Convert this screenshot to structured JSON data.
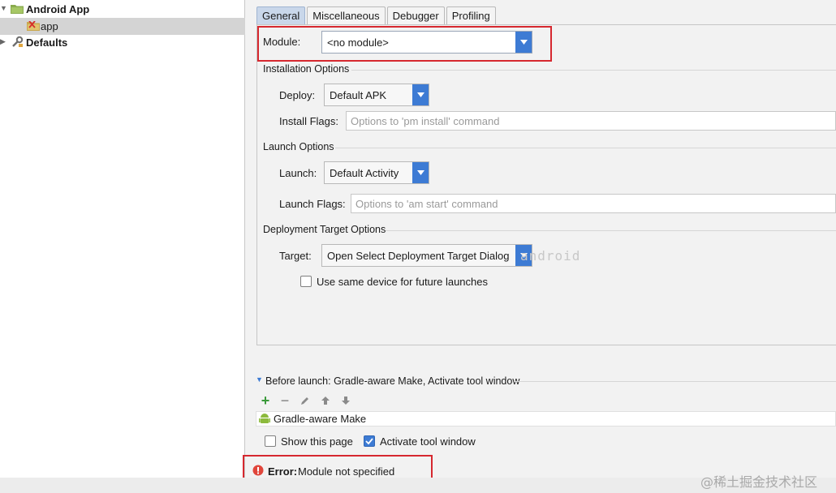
{
  "tree": {
    "root_label": "Android App",
    "child_label": "app",
    "defaults_label": "Defaults"
  },
  "tabs": [
    {
      "label": "General"
    },
    {
      "label": "Miscellaneous"
    },
    {
      "label": "Debugger"
    },
    {
      "label": "Profiling"
    }
  ],
  "general": {
    "module_label": "Module:",
    "module_value": "<no module>",
    "installation_title": "Installation Options",
    "deploy_label": "Deploy:",
    "deploy_value": "Default APK",
    "install_flags_label": "Install Flags:",
    "install_flags_placeholder": "Options to 'pm install' command",
    "launch_title": "Launch Options",
    "launch_label": "Launch:",
    "launch_value": "Default Activity",
    "launch_flags_label": "Launch Flags:",
    "launch_flags_placeholder": "Options to 'am start' command",
    "deployment_title": "Deployment Target Options",
    "target_label": "Target:",
    "target_value": "Open Select Deployment Target Dialog",
    "same_device_label": "Use same device for future launches"
  },
  "before_launch": {
    "title": "Before launch: Gradle-aware Make, Activate tool window",
    "items": [
      "Gradle-aware Make"
    ],
    "show_page_label": "Show this page",
    "activate_label": "Activate tool window"
  },
  "error": {
    "prefix": "Error:",
    "message": "Module not specified"
  },
  "watermark": "@稀土掘金技术社区",
  "ghost_watermark": "android",
  "colors": {
    "accent": "#3d7bd4",
    "highlight_box": "#d6282f",
    "error_icon": "#e0463b"
  }
}
